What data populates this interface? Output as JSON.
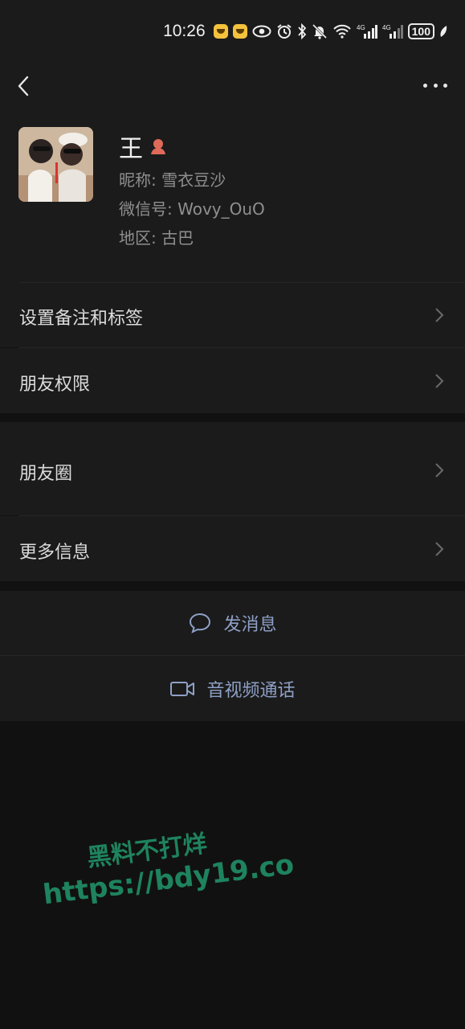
{
  "status_bar": {
    "time": "10:26",
    "network_1": "4G",
    "network_2": "4G",
    "battery": "100"
  },
  "profile": {
    "name": "王",
    "nickname_label": "昵称: ",
    "nickname": "雪衣豆沙",
    "wechat_id_label": "微信号: ",
    "wechat_id": "Wovy_OuO",
    "region_label": "地区: ",
    "region": "古巴"
  },
  "menu": {
    "remark_tags": "设置备注和标签",
    "friend_permissions": "朋友权限",
    "moments": "朋友圈",
    "more_info": "更多信息"
  },
  "actions": {
    "send_message": "发消息",
    "video_call": "音视频通话"
  },
  "watermark": {
    "line1": "黑料不打烊",
    "line2": "https://bdy19.co"
  },
  "colors": {
    "background": "#111111",
    "panel": "#1b1b1b",
    "action_text": "#8ea0c6",
    "watermark": "#1f8a64",
    "gender_icon": "#e06a5a"
  }
}
